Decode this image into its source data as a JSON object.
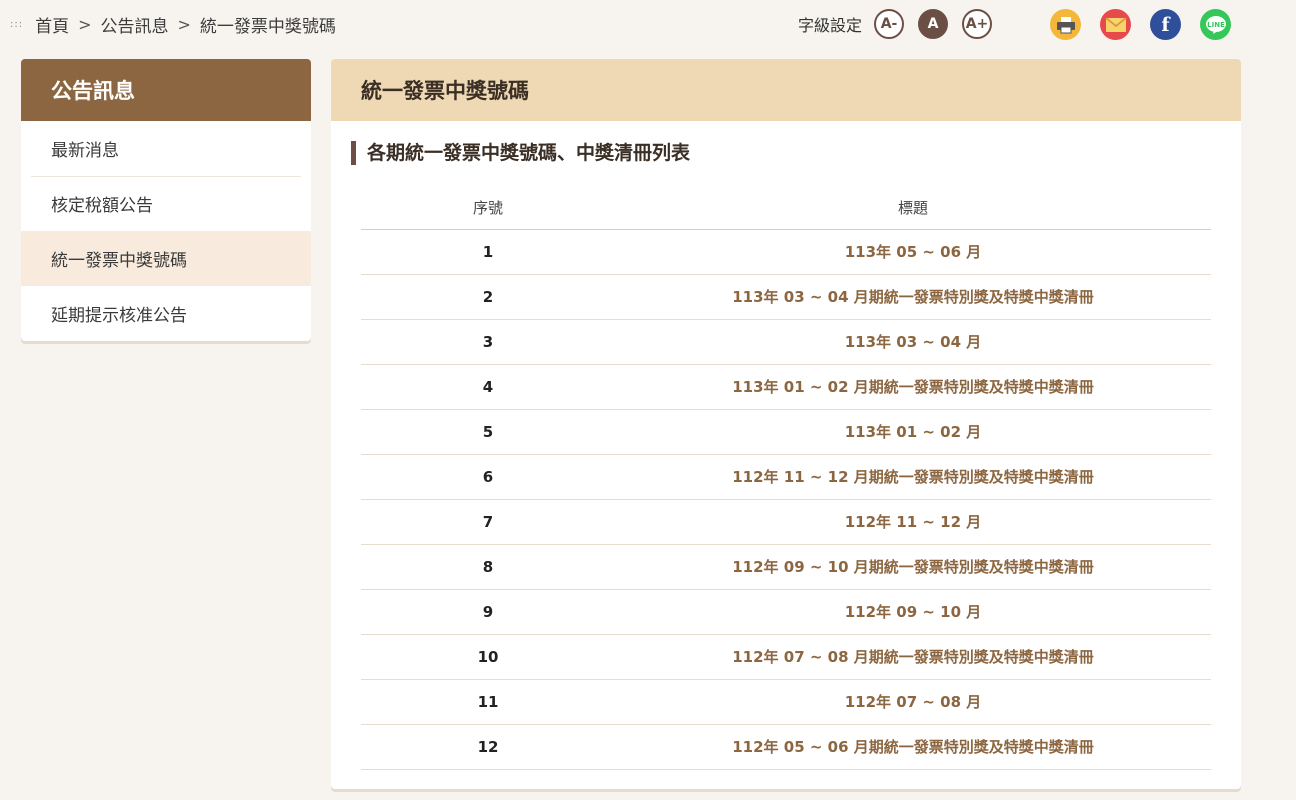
{
  "breadcrumb": {
    "dots": ":::",
    "items": [
      "首頁",
      "公告訊息",
      "統一發票中獎號碼"
    ],
    "separator": ">"
  },
  "font_setting": {
    "label": "字級設定",
    "small": "A-",
    "medium": "A",
    "large": "A+",
    "active": "medium"
  },
  "share": [
    "print-icon",
    "mail-icon",
    "facebook-icon",
    "line-icon"
  ],
  "share_text": {
    "facebook": "f",
    "line": "LINE"
  },
  "sidebar": {
    "title": "公告訊息",
    "items": [
      {
        "label": "最新消息"
      },
      {
        "label": "核定稅額公告"
      },
      {
        "label": "統一發票中獎號碼",
        "active": true
      },
      {
        "label": "延期提示核准公告"
      }
    ]
  },
  "main": {
    "title": "統一發票中獎號碼",
    "subtitle": "各期統一發票中獎號碼、中獎清冊列表",
    "table": {
      "headers": [
        "序號",
        "標題"
      ],
      "rows": [
        {
          "no": "1",
          "title": "113年 05 ~ 06 月"
        },
        {
          "no": "2",
          "title": "113年 03 ~ 04 月期統一發票特別獎及特獎中獎清冊"
        },
        {
          "no": "3",
          "title": "113年 03 ~ 04 月"
        },
        {
          "no": "4",
          "title": "113年 01 ~ 02 月期統一發票特別獎及特獎中獎清冊"
        },
        {
          "no": "5",
          "title": "113年 01 ~ 02 月"
        },
        {
          "no": "6",
          "title": "112年 11 ~ 12 月期統一發票特別獎及特獎中獎清冊"
        },
        {
          "no": "7",
          "title": "112年 11 ~ 12 月"
        },
        {
          "no": "8",
          "title": "112年 09 ~ 10 月期統一發票特別獎及特獎中獎清冊"
        },
        {
          "no": "9",
          "title": "112年 09 ~ 10 月"
        },
        {
          "no": "10",
          "title": "112年 07 ~ 08 月期統一發票特別獎及特獎中獎清冊"
        },
        {
          "no": "11",
          "title": "112年 07 ~ 08 月"
        },
        {
          "no": "12",
          "title": "112年 05 ~ 06 月期統一發票特別獎及特獎中獎清冊"
        }
      ]
    }
  },
  "colors": {
    "brand_brown": "#8c6640",
    "header_tan": "#efd9b4",
    "active_bg": "#f8ebde",
    "link_color": "#8c6640"
  }
}
